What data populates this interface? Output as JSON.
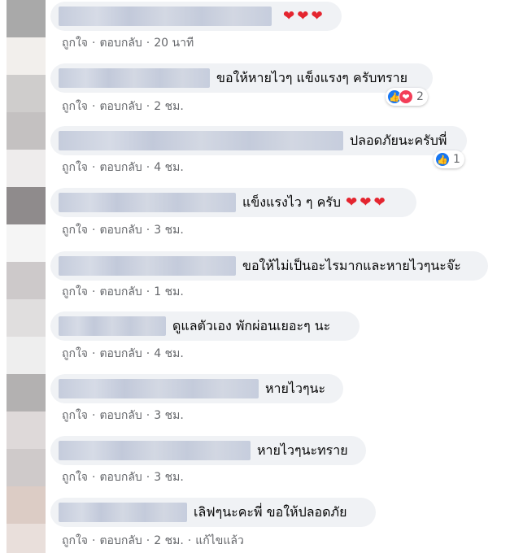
{
  "comments": [
    {
      "text": "",
      "hearts": "❤❤❤",
      "like": "ถูกใจ",
      "reply": "ตอบกลับ",
      "time": "20 นาที"
    },
    {
      "text": "ขอให้หายไวๆ แข็งแรงๆ ครับทราย",
      "like": "ถูกใจ",
      "reply": "ตอบกลับ",
      "time": "2 ชม.",
      "reaction_count": "2"
    },
    {
      "text": "ปลอดภัยนะครับพี่",
      "like": "ถูกใจ",
      "reply": "ตอบกลับ",
      "time": "4 ชม.",
      "reaction_count": "1"
    },
    {
      "text": "แข็งแรงไว ๆ ครับ",
      "hearts": "❤❤❤",
      "like": "ถูกใจ",
      "reply": "ตอบกลับ",
      "time": "3 ชม."
    },
    {
      "text": "ขอให้ไม่เป็นอะไรมากและหายไวๆนะจ๊ะ",
      "like": "ถูกใจ",
      "reply": "ตอบกลับ",
      "time": "1 ชม."
    },
    {
      "text": "ดูแลตัวเอง พักผ่อนเยอะๆ นะ",
      "like": "ถูกใจ",
      "reply": "ตอบกลับ",
      "time": "4 ชม."
    },
    {
      "text": "หายไวๆนะ",
      "like": "ถูกใจ",
      "reply": "ตอบกลับ",
      "time": "3 ชม."
    },
    {
      "text": "หายไวๆนะทราย",
      "like": "ถูกใจ",
      "reply": "ตอบกลับ",
      "time": "3 ชม."
    },
    {
      "text": "เลิฟๆนะคะพี่ ขอให้ปลอดภัย",
      "like": "ถูกใจ",
      "reply": "ตอบกลับ",
      "time": "2 ชม.",
      "edited": "แก้ไขแล้ว"
    }
  ],
  "colors": {
    "bubble": "#f0f2f5",
    "meta_text": "#65676b",
    "heart": "#e4252f",
    "like_blue": "#1877f2",
    "love_red": "#f33e58"
  },
  "icons": {
    "like": "like-icon",
    "love": "love-icon",
    "heart": "heart-icon"
  }
}
